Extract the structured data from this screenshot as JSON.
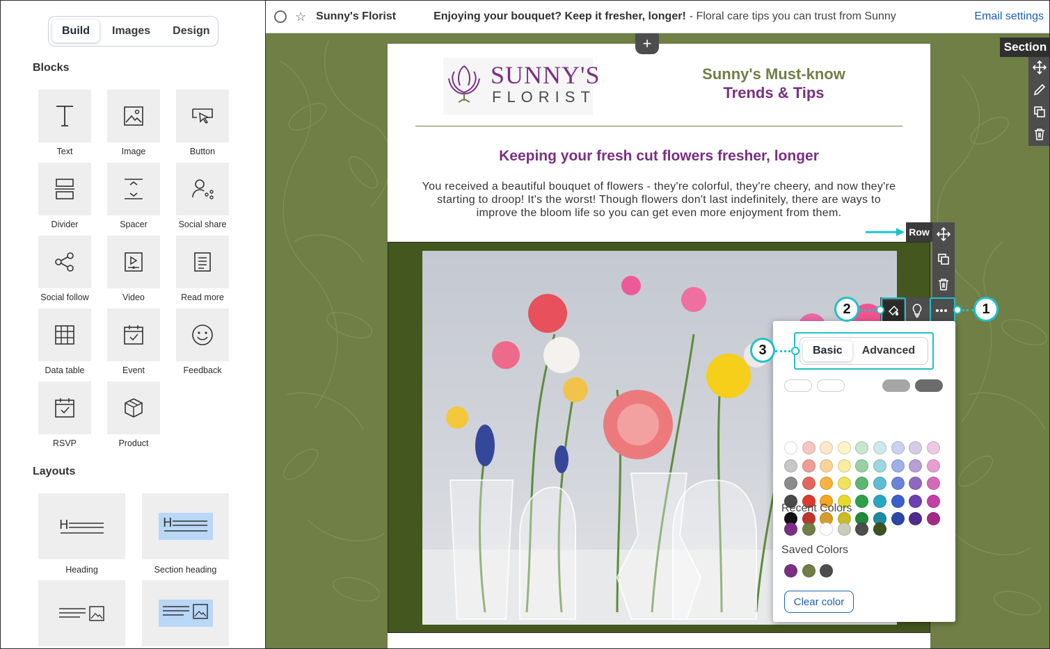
{
  "sidebar": {
    "tabs": [
      {
        "label": "Build"
      },
      {
        "label": "Images"
      },
      {
        "label": "Design"
      }
    ],
    "blocks_heading": "Blocks",
    "blocks": [
      {
        "label": "Text",
        "icon": "text-icon"
      },
      {
        "label": "Image",
        "icon": "image-icon"
      },
      {
        "label": "Button",
        "icon": "button-icon"
      },
      {
        "label": "Divider",
        "icon": "divider-icon"
      },
      {
        "label": "Spacer",
        "icon": "spacer-icon"
      },
      {
        "label": "Social share",
        "icon": "social-share-icon"
      },
      {
        "label": "Social follow",
        "icon": "social-follow-icon"
      },
      {
        "label": "Video",
        "icon": "video-icon"
      },
      {
        "label": "Read more",
        "icon": "read-more-icon"
      },
      {
        "label": "Data table",
        "icon": "data-table-icon"
      },
      {
        "label": "Event",
        "icon": "event-icon"
      },
      {
        "label": "Feedback",
        "icon": "feedback-icon"
      },
      {
        "label": "RSVP",
        "icon": "rsvp-icon"
      },
      {
        "label": "Product",
        "icon": "product-icon"
      }
    ],
    "layouts_heading": "Layouts",
    "layouts": [
      {
        "label": "Heading"
      },
      {
        "label": "Section heading"
      }
    ]
  },
  "topbar": {
    "name": "Sunny's Florist",
    "subject": "Enjoying your bouquet? Keep it fresher, longer!",
    "preheader": "- Floral care tips you can trust from Sunny",
    "settings": "Email settings"
  },
  "email": {
    "logo_line1": "SUNNY'S",
    "logo_line2": "FLORIST",
    "title_line1": "Sunny's Must-know",
    "title_line2": "Trends & Tips",
    "heading": "Keeping your fresh cut flowers fresher, longer",
    "body": "You received a beautiful bouquet of flowers - they're colorful, they're cheery, and now they're starting to droop! It's the worst! Though flowers don't last indefinitely, there are ways to improve the bloom life so you can get even more enjoyment from them."
  },
  "toolbars": {
    "section_label": "Section",
    "row_label": "Row"
  },
  "color_popup": {
    "tabs": [
      {
        "label": "Basic"
      },
      {
        "label": "Advanced"
      }
    ],
    "selected_tab": "Basic",
    "pills": [
      "#ffffff",
      "#ffffff",
      "#ffffff",
      "#a6a6a6",
      "#6b6b6b"
    ],
    "palette": [
      [
        "#ffffff",
        "#f4c7c3",
        "#fde8c8",
        "#fbf6c8",
        "#c9e6cf",
        "#cde8ef",
        "#c9d3f0",
        "#d8cbe6",
        "#efc8e4"
      ],
      [
        "#c7c7c7",
        "#ee9d96",
        "#fbd39b",
        "#f6ee9e",
        "#97d0a2",
        "#9dd6e2",
        "#9fb0e6",
        "#b79ed4",
        "#e59fd0"
      ],
      [
        "#8c8c8c",
        "#e4665b",
        "#f8b43e",
        "#efe15a",
        "#5eb672",
        "#5ebdd2",
        "#6a83d8",
        "#8f68c0",
        "#d56abb"
      ],
      [
        "#4a4a4a",
        "#dc3b2e",
        "#f5a623",
        "#e5dc2a",
        "#2fa04a",
        "#26a7c1",
        "#3b5fc9",
        "#6c3fb1",
        "#c43ea6"
      ],
      [
        "#111111",
        "#c0352a",
        "#d69c2c",
        "#c8bd26",
        "#1f8a3a",
        "#1d8aa2",
        "#2b48a8",
        "#4f2a8f",
        "#a52a87"
      ]
    ],
    "recent_heading": "Recent Colors",
    "recent": [
      "#7a2f83",
      "#6f7f45",
      "#ffffff",
      "#c9cdb8",
      "#4d4d4d",
      "#3d5121"
    ],
    "saved_heading": "Saved Colors",
    "saved": [
      "#7a2f83",
      "#6f7f45",
      "#4d4d4d"
    ],
    "clear_label": "Clear color"
  },
  "callouts": [
    "1",
    "2",
    "3"
  ],
  "colors": {
    "accent_cyan": "#1fc1c9",
    "brand_purple": "#7a2f83",
    "brand_green": "#6f7f45"
  }
}
